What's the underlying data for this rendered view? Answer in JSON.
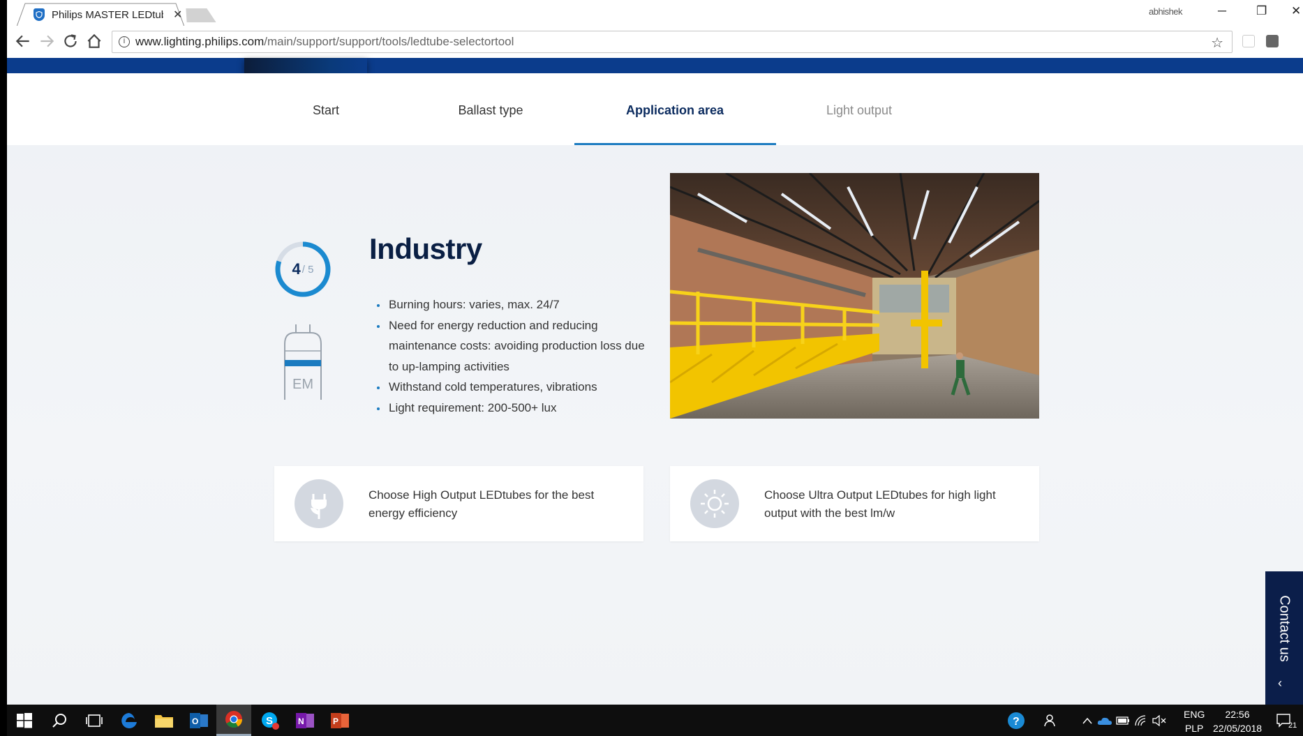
{
  "browser": {
    "tab_title": "Philips MASTER LEDtube",
    "tab_close": "✕",
    "profile_name": "abhishek",
    "url_domain": "www.lighting.philips.com",
    "url_path": "/main/support/support/tools/ledtube-selectortool",
    "controls": {
      "minimize": "─",
      "restore": "❐",
      "close": "✕"
    }
  },
  "stepper": {
    "steps": [
      {
        "label": "Start",
        "state": "done"
      },
      {
        "label": "Ballast type",
        "state": "done"
      },
      {
        "label": "Application area",
        "state": "active"
      },
      {
        "label": "Light output",
        "state": "upcoming"
      }
    ]
  },
  "progress": {
    "current": "4",
    "total": "/ 5",
    "fraction": 0.8
  },
  "tube_icon_label": "EM",
  "application": {
    "title": "Industry",
    "bullets": [
      "Burning hours: varies, max. 24/7",
      "Need for energy reduction and reducing maintenance costs: avoiding production loss due to up-lamping activities",
      "Withstand cold temperatures, vibrations",
      "Light requirement: 200-500+ lux"
    ]
  },
  "cards": [
    {
      "icon": "plug-leaf-icon",
      "text": "Choose High Output LEDtubes for the best energy efficiency"
    },
    {
      "icon": "sun-icon",
      "text": "Choose Ultra Output LEDtubes for high light output with the best lm/w"
    }
  ],
  "contact": {
    "label": "Contact us",
    "chevron": "‹"
  },
  "taskbar": {
    "lang_top": "ENG",
    "lang_bottom": "PLP",
    "time": "22:56",
    "date": "22/05/2018",
    "notifications": "21"
  },
  "colors": {
    "brand_blue": "#0b3c8c",
    "accent": "#1b7bc0",
    "heading": "#0a1f44"
  }
}
